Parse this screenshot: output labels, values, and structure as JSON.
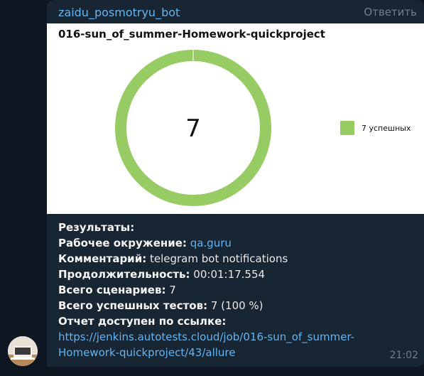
{
  "message": {
    "sender": "zaidu_posmotryu_bot",
    "reply_label": "Ответить",
    "time": "21:02"
  },
  "chart_data": {
    "type": "pie",
    "title": "016-sun_of_summer-Homework-quickproject",
    "center_label": "7",
    "slices": [
      {
        "label": "7 успешных",
        "value": 7,
        "color": "#97cc64"
      }
    ],
    "legend_position": "right"
  },
  "results": {
    "heading": "Результаты:",
    "env_label": "Рабочее окружение:",
    "env_value": "qa.guru",
    "comment_label": "Комментарий:",
    "comment_value": "telegram bot notifications",
    "duration_label": "Продолжительность:",
    "duration_value": "00:01:17.554",
    "scenarios_label": "Всего сценариев:",
    "scenarios_value": "7",
    "passed_label": "Всего успешных тестов:",
    "passed_value": "7 (100 %)",
    "report_label": "Отчет доступен по ссылке:",
    "report_url_line1": "https://jenkins.autotests.cloud/job/016-sun_of_summer-",
    "report_url_line2": "Homework-quickproject/43/allure"
  }
}
